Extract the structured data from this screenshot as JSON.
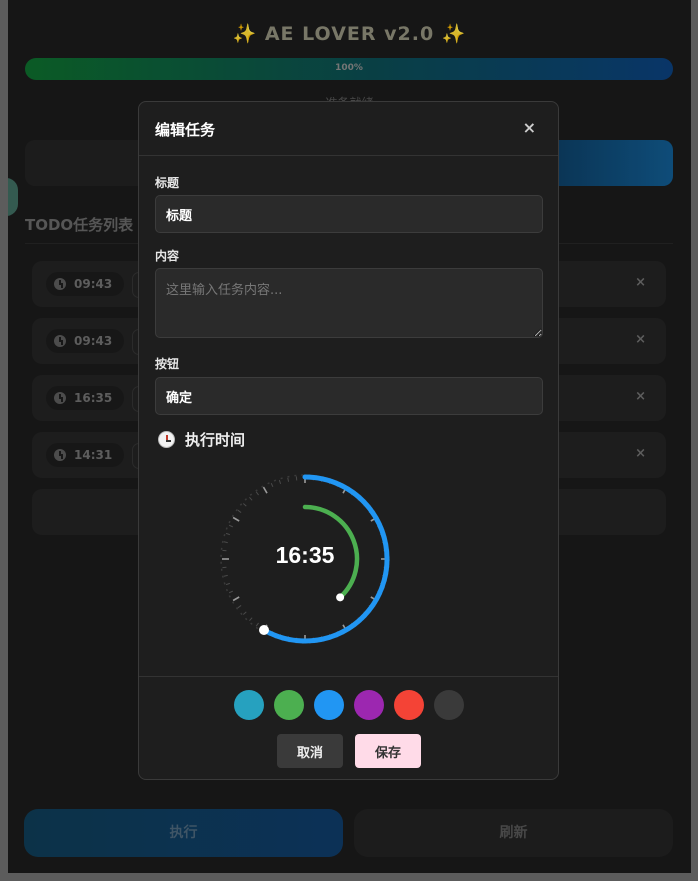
{
  "app": {
    "title": "AE LOVER v2.0",
    "spark": "✨",
    "progress_percent": 100,
    "progress_text": "100%",
    "status_text": "准备就绪",
    "todo_heading": "TODO任务列表",
    "tasks": [
      {
        "time": "09:43"
      },
      {
        "time": "09:43"
      },
      {
        "time": "16:35"
      },
      {
        "time": "14:31"
      }
    ],
    "run_label": "执行",
    "refresh_label": "刷新",
    "close_icon": "×"
  },
  "modal": {
    "title": "编辑任务",
    "close_icon": "×",
    "title_label": "标题",
    "title_value": "标题",
    "content_label": "内容",
    "content_placeholder": "这里输入任务内容...",
    "button_label": "按钮",
    "button_value": "确定",
    "exec_time_label": "执行时间",
    "time_display": "16:35",
    "time": {
      "hour": 16,
      "minute": 35
    },
    "colors": [
      "#26a1bf",
      "#4caf50",
      "#2196f3",
      "#9c27b0",
      "#f44336",
      "#3a3a3a"
    ],
    "cancel_label": "取消",
    "save_label": "保存"
  },
  "colors": {
    "accent_blue": "#2196f3",
    "accent_green": "#4caf50",
    "save_bg": "#ffdbe8"
  }
}
